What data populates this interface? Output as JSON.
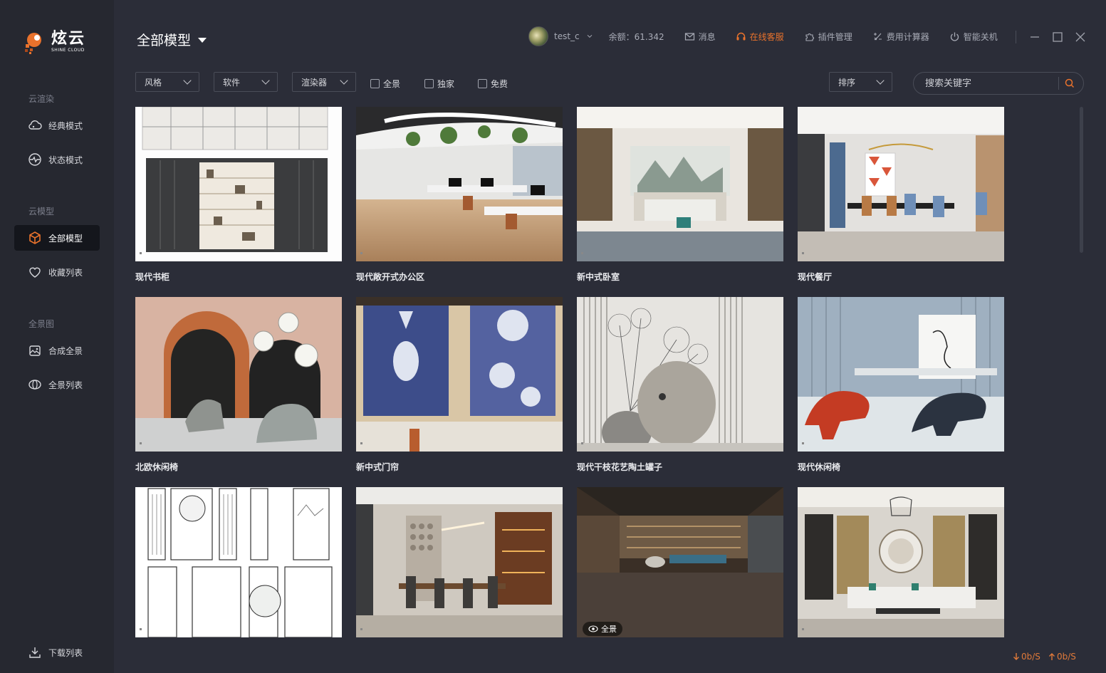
{
  "app": {
    "logo_main": "炫云",
    "logo_sub": "SHINE CLOUD",
    "brand_colors": {
      "orange": "#e9722c",
      "bg": "#2b2d38",
      "sidebar": "#262830"
    }
  },
  "sidebar": {
    "sections": [
      {
        "title": "云渲染",
        "items": [
          {
            "label": "经典模式",
            "icon": "cloud-icon"
          },
          {
            "label": "状态模式",
            "icon": "status-icon"
          }
        ]
      },
      {
        "title": "云模型",
        "items": [
          {
            "label": "全部模型",
            "icon": "cube-icon",
            "active": true
          },
          {
            "label": "收藏列表",
            "icon": "heart-icon"
          }
        ]
      },
      {
        "title": "全景图",
        "items": [
          {
            "label": "合成全景",
            "icon": "panorama-compose-icon"
          },
          {
            "label": "全景列表",
            "icon": "panorama-list-icon"
          }
        ]
      }
    ],
    "download": "下载列表"
  },
  "header": {
    "title": "全部模型",
    "username": "test_c",
    "balance": "余额：61.342",
    "messages": "消息",
    "support": "在线客服",
    "plugins": "插件管理",
    "calculator": "费用计算器",
    "shutdown": "智能关机"
  },
  "filters": {
    "style": "风格",
    "software": "软件",
    "renderer": "渲染器",
    "panorama": "全景",
    "exclusive": "独家",
    "free": "免费",
    "sort": "排序",
    "search_placeholder": "搜索关键字"
  },
  "models": [
    {
      "title": "现代书柜"
    },
    {
      "title": "现代敞开式办公区"
    },
    {
      "title": "新中式卧室"
    },
    {
      "title": "现代餐厅"
    },
    {
      "title": "北欧休闲椅"
    },
    {
      "title": "新中式门帘"
    },
    {
      "title": "现代干枝花艺陶土罐子"
    },
    {
      "title": "现代休闲椅"
    },
    {
      "title": ""
    },
    {
      "title": ""
    },
    {
      "title": "",
      "badge": "全景"
    },
    {
      "title": ""
    }
  ],
  "status": {
    "download_speed": "0b/S",
    "upload_speed": "0b/S"
  }
}
